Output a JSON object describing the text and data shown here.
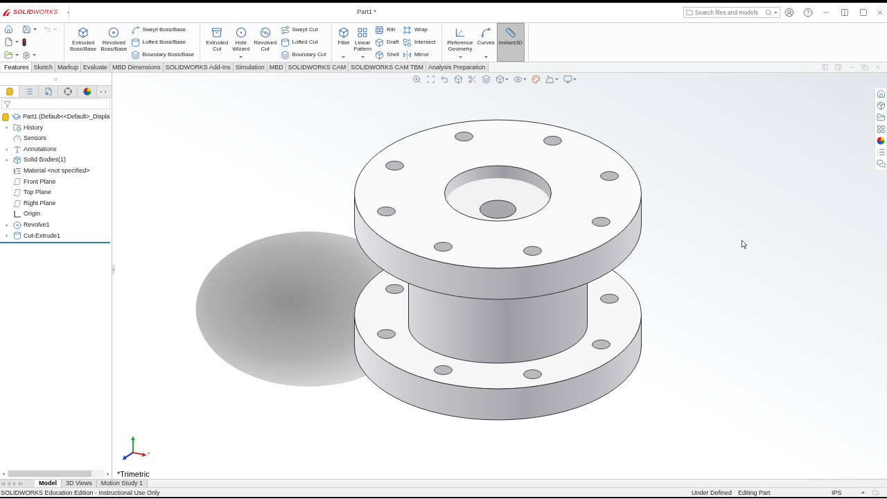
{
  "title_bar": {
    "logo": "**SOLID**WORKS",
    "title": "Part1 *",
    "search": {
      "placeholder": "Search files and models"
    }
  },
  "quick_access": {
    "undo": {
      "disabled": true
    }
  },
  "ribbon": {
    "groups": [
      {
        "large": [
          {
            "label": "Extruded\nBoss/Base",
            "dropdown": false,
            "selected": false
          },
          {
            "label": "Revolved\nBoss/Base",
            "dropdown": false,
            "selected": false
          }
        ],
        "small_columns": [
          [
            {
              "label": "Swept Boss/Base"
            },
            {
              "label": "Lofted Boss/Base"
            },
            {
              "label": "Boundary Boss/Base"
            }
          ]
        ]
      },
      {
        "large": [
          {
            "label": "Extruded\nCut",
            "dropdown": false,
            "selected": false
          },
          {
            "label": "Hole\nWizard",
            "dropdown": true,
            "selected": false
          },
          {
            "label": "Revolved\nCut",
            "dropdown": false,
            "selected": false
          }
        ],
        "small_columns": [
          [
            {
              "label": "Swept Cut"
            },
            {
              "label": "Lofted Cut"
            },
            {
              "label": "Boundary Cut"
            }
          ]
        ]
      },
      {
        "large": [
          {
            "label": "Fillet",
            "dropdown": true,
            "selected": false
          },
          {
            "label": "Linear\nPattern",
            "dropdown": true,
            "selected": false
          }
        ],
        "small_columns": [
          [
            {
              "label": "Rib"
            },
            {
              "label": "Draft"
            },
            {
              "label": "Shell"
            }
          ],
          [
            {
              "label": "Wrap"
            },
            {
              "label": "Intersect"
            },
            {
              "label": "Mirror"
            }
          ]
        ]
      },
      {
        "large": [
          {
            "label": "Reference\nGeometry",
            "dropdown": true,
            "selected": false
          },
          {
            "label": "Curves",
            "dropdown": true,
            "selected": false
          },
          {
            "label": "Instant3D",
            "dropdown": false,
            "selected": true
          }
        ]
      }
    ]
  },
  "tabs": [
    {
      "label": "Features",
      "selected": true
    },
    {
      "label": "Sketch",
      "selected": false
    },
    {
      "label": "Markup",
      "selected": false
    },
    {
      "label": "Evaluate",
      "selected": false
    },
    {
      "label": "MBD Dimensions",
      "selected": false
    },
    {
      "label": "SOLIDWORKS Add-Ins",
      "selected": false
    },
    {
      "label": "Simulation",
      "selected": false
    },
    {
      "label": "MBD",
      "selected": false
    },
    {
      "label": "SOLIDWORKS CAM",
      "selected": false
    },
    {
      "label": "SOLIDWORKS CAM TBM",
      "selected": false
    },
    {
      "label": "Analysis Preparation",
      "selected": false
    }
  ],
  "feature_manager": {
    "panel_tabs": [
      {
        "kind": "features",
        "selected": true
      },
      {
        "kind": "properties",
        "selected": false
      },
      {
        "kind": "configurations",
        "selected": false
      },
      {
        "kind": "dimxpert",
        "selected": false
      },
      {
        "kind": "display",
        "selected": false
      }
    ],
    "tree": {
      "label": "Part1 (Default<<Default>_Displa",
      "children": [
        {
          "label": "History",
          "kind": "history",
          "expandable": true
        },
        {
          "label": "Sensors",
          "kind": "sensors",
          "expandable": false
        },
        {
          "label": "Annotations",
          "kind": "annotations",
          "expandable": true
        },
        {
          "label": "Solid Bodies(1)",
          "kind": "bodies",
          "expandable": true
        },
        {
          "label": "Material <not specified>",
          "kind": "material",
          "expandable": false
        },
        {
          "label": "Front Plane",
          "kind": "plane",
          "expandable": false
        },
        {
          "label": "Top Plane",
          "kind": "plane",
          "expandable": false
        },
        {
          "label": "Right Plane",
          "kind": "plane",
          "expandable": false
        },
        {
          "label": "Origin",
          "kind": "origin",
          "expandable": false
        },
        {
          "label": "Revolve1",
          "kind": "revolve",
          "expandable": true
        },
        {
          "label": "Cut-Extrude1",
          "kind": "cut_extrude",
          "expandable": true
        }
      ]
    }
  },
  "viewport": {
    "axis_label": "x",
    "view_label": "*Trimetric"
  },
  "bottom_tabs": [
    {
      "label": "Model",
      "selected": true
    },
    {
      "label": "3D Views",
      "selected": false
    },
    {
      "label": "Motion Study 1",
      "selected": false
    }
  ],
  "status_bar": {
    "message": "SOLIDWORKS Education Edition - Instructional Use Only",
    "fields": [
      "Under Defined",
      "Editing Part",
      "IPS"
    ]
  }
}
